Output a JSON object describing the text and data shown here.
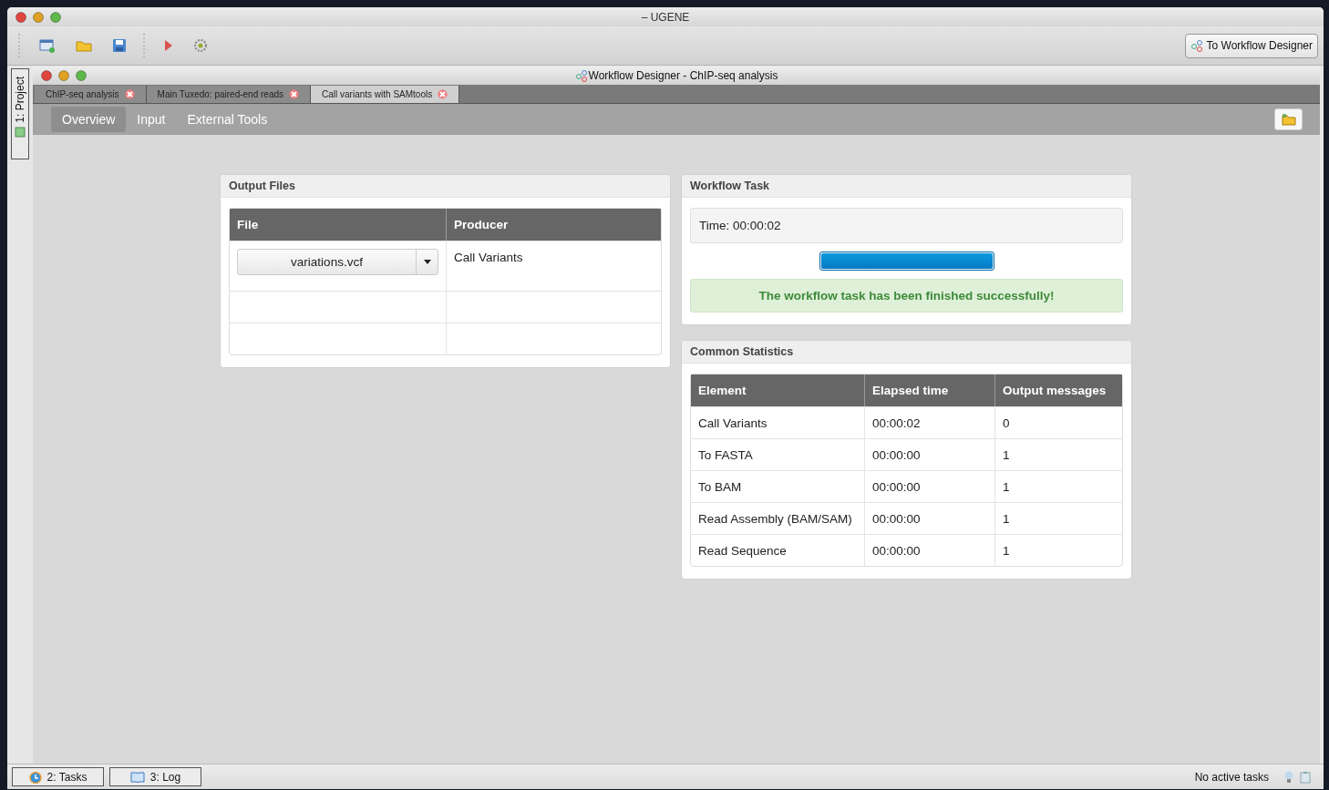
{
  "window": {
    "title": "– UGENE"
  },
  "toolbar": {
    "action_button": "To Workflow Designer"
  },
  "side_panel": {
    "tabs": [
      {
        "label": "1: Project"
      }
    ]
  },
  "document_window": {
    "title": "Workflow Designer - ChIP-seq analysis",
    "tabs": [
      {
        "label": "ChIP-seq analysis",
        "selected": false
      },
      {
        "label": "Main Tuxedo: paired-end reads",
        "selected": false
      },
      {
        "label": "Call variants with SAMtools",
        "selected": true
      }
    ],
    "nav": [
      {
        "label": "Overview",
        "selected": true
      },
      {
        "label": "Input",
        "selected": false
      },
      {
        "label": "External Tools",
        "selected": false
      }
    ],
    "output_files": {
      "title": "Output Files",
      "columns": [
        "File",
        "Producer"
      ],
      "rows": [
        {
          "kind": "file",
          "file": "variations.vcf",
          "producer": "Call Variants"
        },
        {
          "kind": "empty"
        },
        {
          "kind": "empty"
        }
      ]
    },
    "workflow_task": {
      "title": "Workflow Task",
      "time": "Time: 00:00:02",
      "progress": {
        "level": 1
      },
      "message": "The workflow task has been finished successfully!"
    },
    "common_statistics": {
      "title": "Common Statistics",
      "columns": [
        "Element",
        "Elapsed time",
        "Output messages"
      ],
      "rows": [
        [
          "Call Variants",
          "00:00:02",
          "0"
        ],
        [
          "To FASTA",
          "00:00:00",
          "1"
        ],
        [
          "To BAM",
          "00:00:00",
          "1"
        ],
        [
          "Read Assembly (BAM/SAM)",
          "00:00:00",
          "1"
        ],
        [
          "Read Sequence",
          "00:00:00",
          "1"
        ]
      ]
    }
  },
  "status_bar": {
    "buttons": [
      {
        "kind": "tasks",
        "label": "2: Tasks"
      },
      {
        "kind": "log",
        "label": "3: Log"
      }
    ],
    "text": "No active tasks"
  }
}
